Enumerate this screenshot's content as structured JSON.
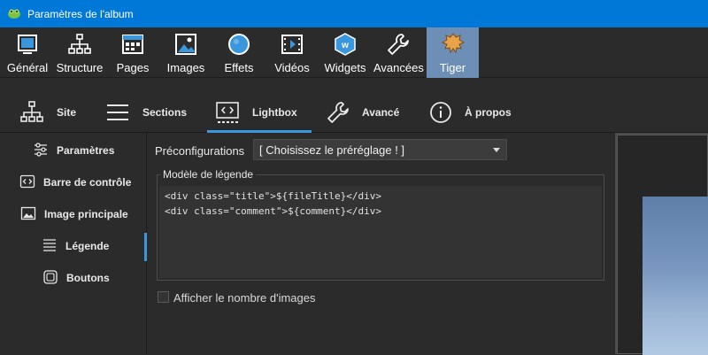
{
  "window": {
    "title": "Paramètres de l'album"
  },
  "toolbar": {
    "items": [
      {
        "label": "Général"
      },
      {
        "label": "Structure"
      },
      {
        "label": "Pages"
      },
      {
        "label": "Images"
      },
      {
        "label": "Effets"
      },
      {
        "label": "Vidéos"
      },
      {
        "label": "Widgets"
      },
      {
        "label": "Avancées"
      },
      {
        "label": "Tiger",
        "active": true
      }
    ]
  },
  "tabs": {
    "items": [
      {
        "label": "Site"
      },
      {
        "label": "Sections"
      },
      {
        "label": "Lightbox",
        "active": true
      },
      {
        "label": "Avancé"
      },
      {
        "label": "À propos"
      }
    ]
  },
  "sidebar": {
    "items": [
      {
        "label": "Paramètres"
      },
      {
        "label": "Barre de contrôle"
      },
      {
        "label": "Image principale"
      },
      {
        "label": "Légende",
        "active": true
      },
      {
        "label": "Boutons"
      }
    ]
  },
  "main": {
    "preset_label": "Préconfigurations",
    "preset_value": "[ Choisissez le préréglage ! ]",
    "caption_group_label": "Modèle de légende",
    "caption_lines": [
      "<div class=\"title\">${fileTitle}</div>",
      "<div class=\"comment\">${comment}</div>"
    ],
    "show_count_label": "Afficher le nombre d'images",
    "show_count_checked": false
  },
  "colors": {
    "titlebar": "#0078d7",
    "active_tool": "#6d8fb5",
    "accent": "#3a96dd",
    "background": "#2b2b2b"
  }
}
